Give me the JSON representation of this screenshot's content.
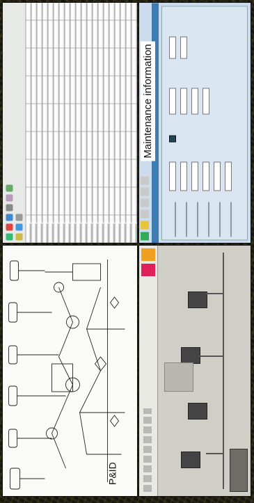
{
  "labels": {
    "pid": "P&ID",
    "maintenance": "Maintenance information"
  },
  "colors": {
    "alarm_red": "#e0205a",
    "alarm_orange": "#f0a020",
    "maint_blue": "#3d7bb2"
  }
}
